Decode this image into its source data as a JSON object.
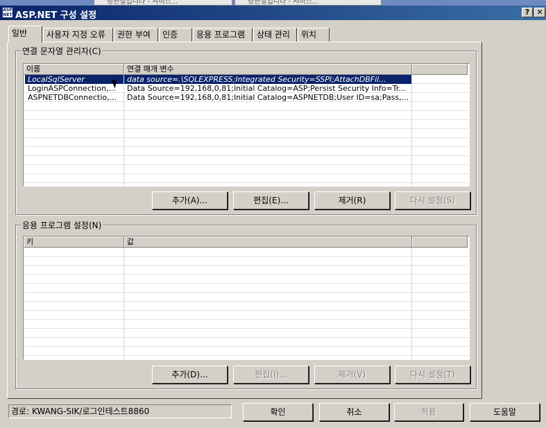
{
  "window": {
    "title": "ASP.NET 구성 설정",
    "icon_text": "ASP NET",
    "help_label": "?",
    "close_label": "✕"
  },
  "tabs": [
    "일반",
    "사용자 지정 오류",
    "권한 부여",
    "인증",
    "응용 프로그램",
    "상태 관리",
    "위치"
  ],
  "connection_group": {
    "title": "연결 문자열 관리자(C)",
    "columns": [
      "이름",
      "연결 매개 변수"
    ],
    "rows": [
      {
        "name": "LocalSqlServer",
        "params": "data source=.\\SQLEXPRESS;Integrated Security=SSPI;AttachDBFil...",
        "selected": true
      },
      {
        "name": "LoginASPConnection,...",
        "params": "Data Source=192,168,0,81;Initial Catalog=ASP;Persist Security Info=Tr...",
        "selected": false
      },
      {
        "name": "ASPNETDBConnectio,...",
        "params": "Data Source=192,168,0,81;Initial Catalog=ASPNETDB;User ID=sa;Pass,...",
        "selected": false
      }
    ],
    "buttons": {
      "add": "추가(A)...",
      "edit": "편집(E)...",
      "remove": "제거(R)",
      "reset": "다시 설정(S)"
    }
  },
  "app_settings_group": {
    "title": "응용 프로그램 설정(N)",
    "columns": [
      "키",
      "값"
    ],
    "buttons": {
      "add": "추가(D)...",
      "edit": "편집(I)...",
      "remove": "제거(V)",
      "reset": "다시 설정(T)"
    }
  },
  "status_path": "경로: KWANG-SIK/로그인테스트8860",
  "footer": {
    "ok": "확인",
    "cancel": "취소",
    "apply": "적용",
    "help": "도움말"
  },
  "background_tabs": [
    "정관설입니다 - 서비스...",
    "정관설입니다 - 서비스..."
  ]
}
